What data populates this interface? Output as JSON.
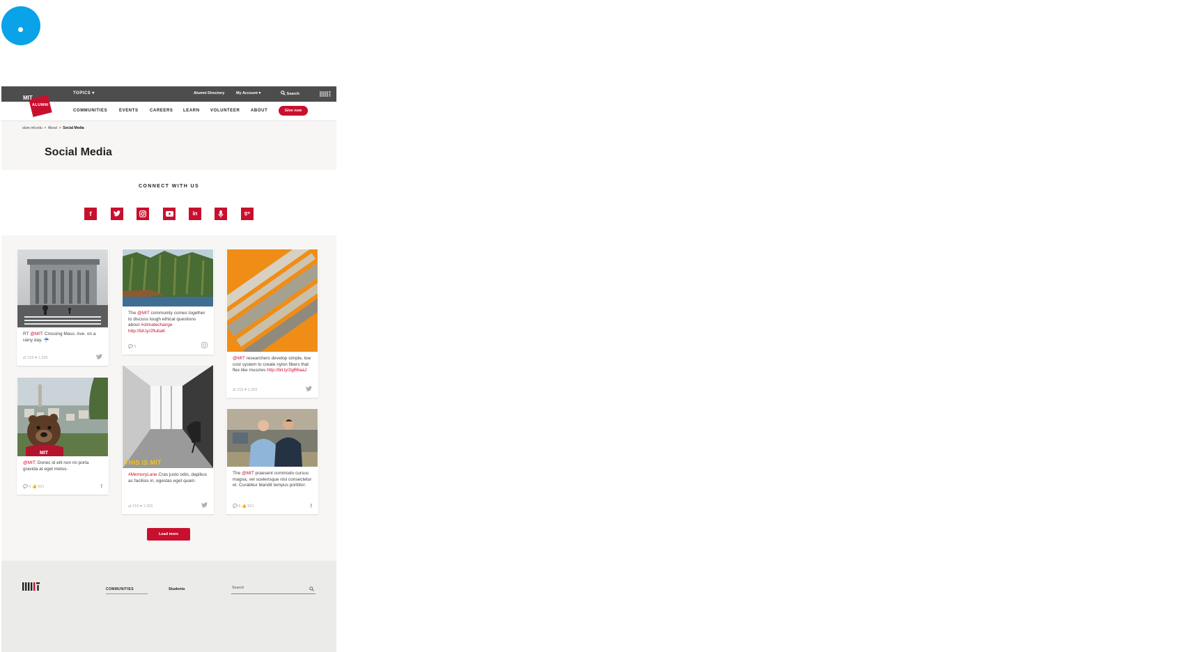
{
  "topbar": {
    "topics": "TOPICS ▾",
    "alumni_directory": "Alumni Directory",
    "my_account": "My Account ▾",
    "search": "Search"
  },
  "logo": {
    "mit": "MIT",
    "alumni": "ALUMNI"
  },
  "nav": {
    "items": [
      "COMMUNITIES",
      "EVENTS",
      "CAREERS",
      "LEARN",
      "VOLUNTEER",
      "ABOUT"
    ],
    "give_now": "Give now"
  },
  "breadcrumb": {
    "home": "alum.mit.edu",
    "sep1": ">",
    "about": "About",
    "sep2": ">",
    "current": "Social Media"
  },
  "page_title": "Social Media",
  "connect": {
    "title": "CONNECT WITH US",
    "icons": [
      "facebook-icon",
      "twitter-icon",
      "instagram-icon",
      "youtube-icon",
      "linkedin-icon",
      "podcast-icon",
      "googleplus-icon"
    ]
  },
  "cards": [
    {
      "pre": "RT ",
      "handle": "@MIT",
      "text": ": Crossing Mass. Ave. on a rainy day. ☔",
      "meta": "⇄ 219  ♥ 1,326",
      "service": "twitter"
    },
    {
      "pre": "",
      "handle": "@MIT",
      "text": ": Donec id elit non mi porta gravida at eget metus.",
      "meta": "💬 5  👍 521",
      "service": "facebook"
    },
    {
      "pre": "The ",
      "handle": "@MIT",
      "text": " community comes together to discuss tough ethical questions about ",
      "tag": "#climatechange",
      "link": "http://bit.ly/2flubaK",
      "meta": "💬 5",
      "service": "instagram"
    },
    {
      "pre": "",
      "handle": "#MemoryLane",
      "text": " Cras justo odio, dapibus ac facilisis in, egestas eget quam.",
      "overlay": "THIS IS MIT",
      "meta": "⇄ 219  ♥ 1,326",
      "service": "twitter"
    },
    {
      "pre": "",
      "handle": "@MIT",
      "text": " researchers develop simple, low cost system to create nylon fibers that flex like muscles ",
      "link": "http://bit.ly/2gB6aaJ",
      "meta": "⇄ 219  ♥ 1,326",
      "service": "twitter"
    },
    {
      "pre": "The ",
      "handle": "@MIT",
      "text": " praesent commodo cursus magna, vel scelerisque nisl consectetur et. Curabitur blandit tempus porttitor.",
      "meta": "💬 5  👍 521",
      "service": "facebook"
    }
  ],
  "load_more": "Load more",
  "footer": {
    "communities": "COMMUNITIES",
    "students": "Students",
    "search_placeholder": "Search"
  },
  "colors": {
    "brand_red": "#c8102e",
    "topbar": "#4d4d4d",
    "cursor_blue": "#0aa2e8"
  }
}
